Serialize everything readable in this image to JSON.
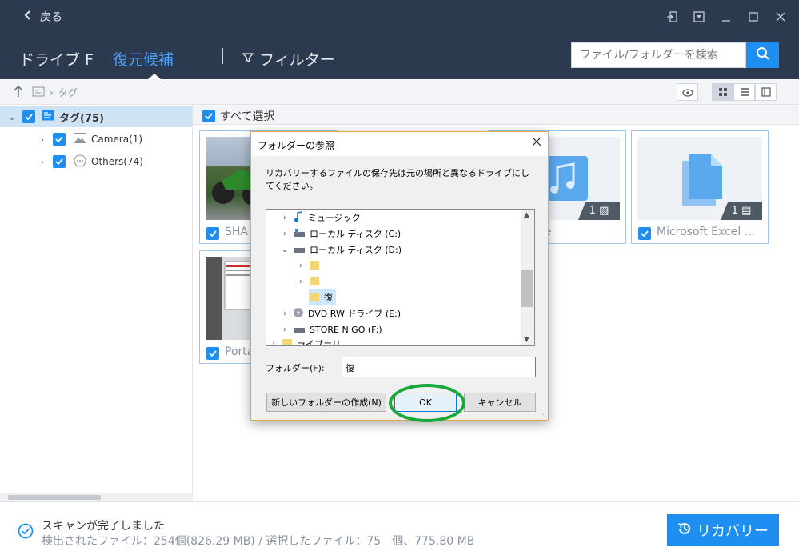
{
  "topbar": {
    "back_label": "戻る"
  },
  "nav": {
    "drive_label": "ドライブ F",
    "recovery_label": "復元候補",
    "filter_label": "フィルター",
    "search_placeholder": "ファイル/フォルダーを検索"
  },
  "path": {
    "segment": "タグ"
  },
  "sidebar": {
    "root_label": "タグ(75)",
    "items": [
      {
        "label": "Camera(1)",
        "icon": "photo-icon"
      },
      {
        "label": "Others(74)",
        "icon": "more-icon"
      }
    ]
  },
  "main": {
    "select_all_label": "すべて選択",
    "cards": [
      {
        "label": "SHA",
        "badge": ""
      },
      {
        "label": "lusic file",
        "badge": "1"
      },
      {
        "label": "Microsoft Excel ...",
        "badge": "1"
      },
      {
        "label": "Porta",
        "badge": ""
      }
    ]
  },
  "status": {
    "line1": "スキャンが完了しました",
    "line2": "検出されたファイル：254個(826.29 MB) / 選択したファイル：75　個、775.80 MB",
    "recover_label": "リカバリー"
  },
  "dialog": {
    "title": "フォルダーの参照",
    "description": "リカバリーするファイルの保存先は元の場所と異なるドライブにしてください。",
    "tree": [
      {
        "label": "ミュージック",
        "icon": "music-icon"
      },
      {
        "label": "ローカル ディスク (C:)",
        "icon": "drive-icon"
      },
      {
        "label": "ローカル ディスク (D:)",
        "icon": "drive-icon"
      },
      {
        "label": "",
        "icon": "folder-icon"
      },
      {
        "label": "",
        "icon": "folder-icon"
      },
      {
        "label": "復",
        "icon": "folder-icon"
      },
      {
        "label": "DVD RW ドライブ (E:)",
        "icon": "dvd-icon"
      },
      {
        "label": "STORE N GO (F:)",
        "icon": "drive-icon"
      },
      {
        "label": "ライブラリ",
        "icon": "folder-icon"
      }
    ],
    "folder_label": "フォルダー(F):",
    "folder_value": "復",
    "new_folder_label": "新しいフォルダーの作成(N)",
    "ok_label": "OK",
    "cancel_label": "キャンセル"
  },
  "colors": {
    "accent": "#1e8ef0",
    "header": "#2c3a4f",
    "highlight": "#1aa83a"
  }
}
